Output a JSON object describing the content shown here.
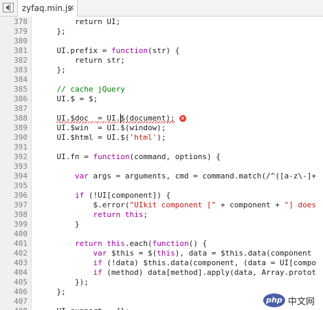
{
  "tab": {
    "filename": "zyfaq.min.js",
    "close_glyph": "×"
  },
  "editor": {
    "current_line": 388,
    "error_line": 388,
    "lines": [
      {
        "num": "378",
        "tokens": [
          [
            "p",
            "        return UI;"
          ]
        ]
      },
      {
        "num": "379",
        "tokens": [
          [
            "p",
            "    };"
          ]
        ]
      },
      {
        "num": "380",
        "tokens": [
          [
            "p",
            ""
          ]
        ]
      },
      {
        "num": "381",
        "tokens": [
          [
            "p",
            "    UI.prefix = "
          ],
          [
            "k",
            "function"
          ],
          [
            "p",
            "(str) {"
          ]
        ]
      },
      {
        "num": "382",
        "tokens": [
          [
            "p",
            "        return str;"
          ]
        ]
      },
      {
        "num": "383",
        "tokens": [
          [
            "p",
            "    };"
          ]
        ]
      },
      {
        "num": "384",
        "tokens": [
          [
            "p",
            ""
          ]
        ]
      },
      {
        "num": "385",
        "tokens": [
          [
            "c",
            "    // cache jQuery"
          ]
        ]
      },
      {
        "num": "386",
        "tokens": [
          [
            "p",
            "    UI.$ = $;"
          ]
        ]
      },
      {
        "num": "387",
        "tokens": [
          [
            "p",
            ""
          ]
        ]
      },
      {
        "num": "388",
        "tokens": [
          [
            "p",
            "    UI.$doc  = UI.$(document);"
          ]
        ]
      },
      {
        "num": "389",
        "tokens": [
          [
            "p",
            "    UI.$win  = UI.$(window);"
          ]
        ]
      },
      {
        "num": "390",
        "tokens": [
          [
            "p",
            "    UI.$html = UI.$("
          ],
          [
            "s",
            "'html'"
          ],
          [
            "p",
            ");"
          ]
        ]
      },
      {
        "num": "391",
        "tokens": [
          [
            "p",
            ""
          ]
        ]
      },
      {
        "num": "392",
        "tokens": [
          [
            "p",
            "    UI.fn = "
          ],
          [
            "k",
            "function"
          ],
          [
            "p",
            "(command, options) {"
          ]
        ]
      },
      {
        "num": "393",
        "tokens": [
          [
            "p",
            ""
          ]
        ]
      },
      {
        "num": "394",
        "tokens": [
          [
            "p",
            "        "
          ],
          [
            "k",
            "var"
          ],
          [
            "p",
            " args = arguments, cmd = command.match(/^([a-z\\-]+"
          ]
        ]
      },
      {
        "num": "395",
        "tokens": [
          [
            "p",
            ""
          ]
        ]
      },
      {
        "num": "396",
        "tokens": [
          [
            "p",
            "        "
          ],
          [
            "k",
            "if"
          ],
          [
            "p",
            " (!UI[component]) {"
          ]
        ]
      },
      {
        "num": "397",
        "tokens": [
          [
            "p",
            "            $.error("
          ],
          [
            "s",
            "\"UIkit component [\""
          ],
          [
            "p",
            " + component + "
          ],
          [
            "s",
            "\"] does"
          ]
        ]
      },
      {
        "num": "398",
        "tokens": [
          [
            "p",
            "            "
          ],
          [
            "k",
            "return"
          ],
          [
            "p",
            " "
          ],
          [
            "k",
            "this"
          ],
          [
            "p",
            ";"
          ]
        ]
      },
      {
        "num": "399",
        "tokens": [
          [
            "p",
            "        }"
          ]
        ]
      },
      {
        "num": "400",
        "tokens": [
          [
            "p",
            ""
          ]
        ]
      },
      {
        "num": "401",
        "tokens": [
          [
            "p",
            "        "
          ],
          [
            "k",
            "return"
          ],
          [
            "p",
            " "
          ],
          [
            "k",
            "this"
          ],
          [
            "p",
            ".each("
          ],
          [
            "k",
            "function"
          ],
          [
            "p",
            "() {"
          ]
        ]
      },
      {
        "num": "402",
        "tokens": [
          [
            "p",
            "            "
          ],
          [
            "k",
            "var"
          ],
          [
            "p",
            " $this = $("
          ],
          [
            "k",
            "this"
          ],
          [
            "p",
            "), data = $this.data(component"
          ]
        ]
      },
      {
        "num": "403",
        "tokens": [
          [
            "p",
            "            "
          ],
          [
            "k",
            "if"
          ],
          [
            "p",
            " (!data) $this.data(component, (data = UI[compo"
          ]
        ]
      },
      {
        "num": "404",
        "tokens": [
          [
            "p",
            "            "
          ],
          [
            "k",
            "if"
          ],
          [
            "p",
            " (method) data[method].apply(data, Array.protot"
          ]
        ]
      },
      {
        "num": "405",
        "tokens": [
          [
            "p",
            "        });"
          ]
        ]
      },
      {
        "num": "406",
        "tokens": [
          [
            "p",
            "    };"
          ]
        ]
      },
      {
        "num": "407",
        "tokens": [
          [
            "p",
            ""
          ]
        ]
      },
      {
        "num": "408",
        "tokens": [
          [
            "p",
            "    UI.support = {};"
          ]
        ]
      }
    ]
  },
  "colors": {
    "keyword": "#a000a0",
    "string": "#c41a16",
    "comment": "#008000",
    "error": "#e53935"
  },
  "watermark": {
    "logo": "php",
    "text": "中文网"
  }
}
